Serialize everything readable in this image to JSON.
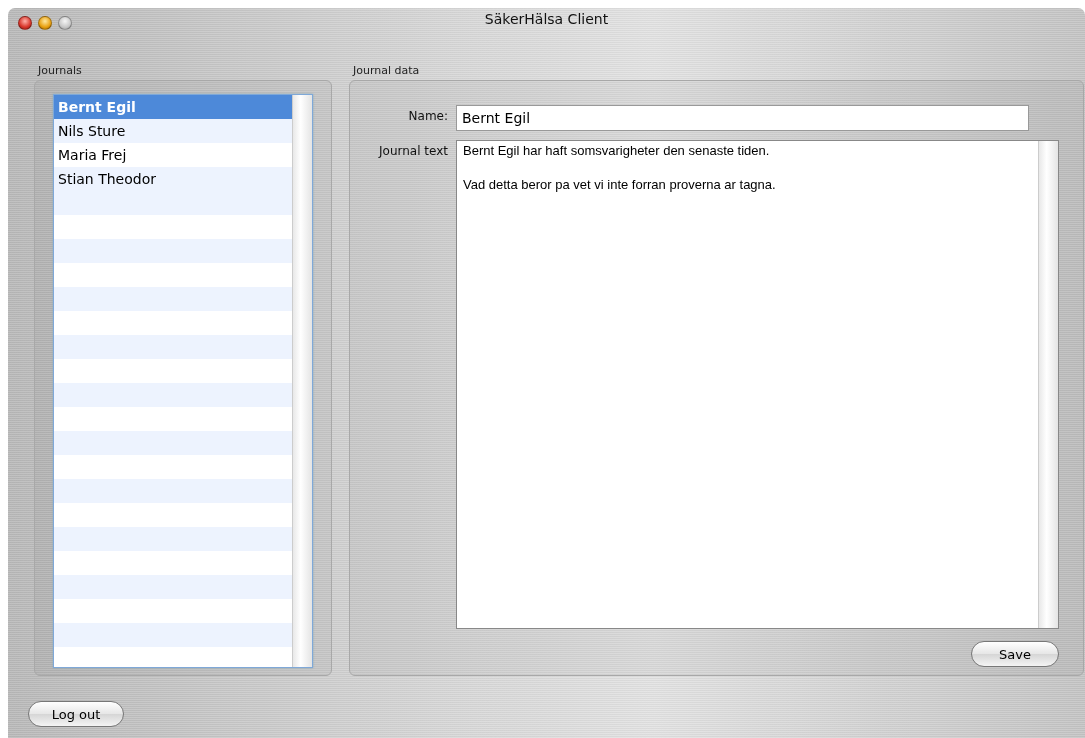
{
  "window": {
    "title": "SäkerHälsa Client"
  },
  "journals": {
    "label": "Journals",
    "items": [
      {
        "name": "Bernt Egil",
        "selected": true
      },
      {
        "name": "Nils Sture",
        "selected": false
      },
      {
        "name": "Maria Frej",
        "selected": false
      },
      {
        "name": "Stian Theodor",
        "selected": false
      }
    ]
  },
  "journal_data": {
    "label": "Journal data",
    "name_label": "Name:",
    "name_value": "Bernt Egil",
    "text_label": "Journal text",
    "text_value": "Bernt Egil har haft somsvarigheter den senaste tiden.\n\nVad detta beror pa vet vi inte forran proverna ar tagna.",
    "save_button": "Save"
  },
  "logout_button": "Log out"
}
